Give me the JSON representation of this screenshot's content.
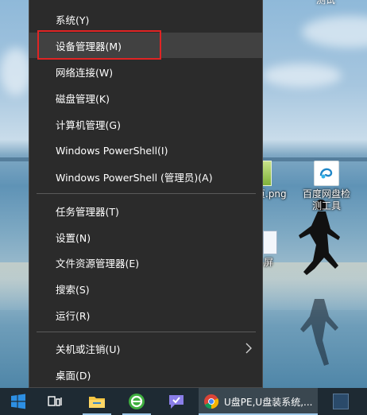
{
  "menu": {
    "items": [
      {
        "label": "系统(Y)"
      },
      {
        "label": "设备管理器(M)"
      },
      {
        "label": "网络连接(W)"
      },
      {
        "label": "磁盘管理(K)"
      },
      {
        "label": "计算机管理(G)"
      },
      {
        "label": "Windows PowerShell(I)"
      },
      {
        "label": "Windows PowerShell (管理员)(A)"
      },
      {
        "label": "任务管理器(T)"
      },
      {
        "label": "设置(N)"
      },
      {
        "label": "文件资源管理器(E)"
      },
      {
        "label": "搜索(S)"
      },
      {
        "label": "运行(R)"
      },
      {
        "label": "关机或注销(U)"
      },
      {
        "label": "桌面(D)"
      }
    ],
    "highlight_color": "#e02424"
  },
  "desktop": {
    "top_right_partial": "测试",
    "icon_png_label": "页.png",
    "icon_baidu_label_line1": "百度网盘检",
    "icon_baidu_label_line2": "测工具",
    "icon_screen_label": "屏"
  },
  "taskbar": {
    "active_window_label": "U盘PE,U盘装系统,..."
  },
  "icons": {
    "start": "windows-start-icon",
    "task_view": "task-view-icon",
    "explorer": "file-explorer-icon",
    "green_app": "green-app-icon",
    "feedback": "feedback-hub-icon",
    "browser": "chrome-icon",
    "submenu": "chevron-right-icon"
  }
}
